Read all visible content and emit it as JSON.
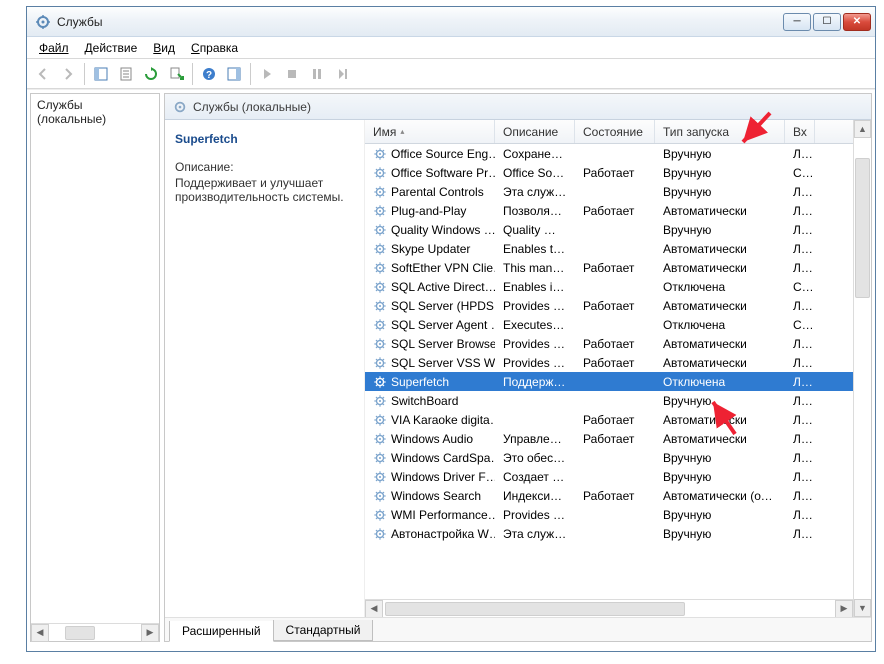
{
  "window": {
    "title": "Службы"
  },
  "menu": {
    "file": "Файл",
    "action": "Действие",
    "view": "Вид",
    "help": "Справка"
  },
  "left_tree": {
    "root": "Службы (локальные)"
  },
  "right_header": {
    "title": "Службы (локальные)"
  },
  "detail": {
    "name": "Superfetch",
    "desc_label": "Описание:",
    "desc_text": "Поддерживает и улучшает производительность системы."
  },
  "columns": {
    "name": "Имя",
    "desc": "Описание",
    "state": "Состояние",
    "start": "Тип запуска",
    "logon": "Вх"
  },
  "services": [
    {
      "name": "Office  Source Eng…",
      "desc": "Сохранен…",
      "state": "",
      "start": "Вручную",
      "logon": "Ло"
    },
    {
      "name": "Office Software Pr…",
      "desc": "Office Soft…",
      "state": "Работает",
      "start": "Вручную",
      "logon": "Се"
    },
    {
      "name": "Parental Controls",
      "desc": "Эта служб…",
      "state": "",
      "start": "Вручную",
      "logon": "Ло"
    },
    {
      "name": "Plug-and-Play",
      "desc": "Позволяет…",
      "state": "Работает",
      "start": "Автоматически",
      "logon": "Ло"
    },
    {
      "name": "Quality Windows …",
      "desc": "Quality Wi…",
      "state": "",
      "start": "Вручную",
      "logon": "Ло"
    },
    {
      "name": "Skype Updater",
      "desc": "Enables th…",
      "state": "",
      "start": "Автоматически",
      "logon": "Ло"
    },
    {
      "name": "SoftEther VPN Clie…",
      "desc": "This mana…",
      "state": "Работает",
      "start": "Автоматически",
      "logon": "Ло"
    },
    {
      "name": "SQL Active Direct…",
      "desc": "Enables int…",
      "state": "",
      "start": "Отключена",
      "logon": "Се"
    },
    {
      "name": "SQL Server (HPDS…",
      "desc": "Provides st…",
      "state": "Работает",
      "start": "Автоматически",
      "logon": "Ло"
    },
    {
      "name": "SQL Server Agent …",
      "desc": "Executes jo…",
      "state": "",
      "start": "Отключена",
      "logon": "Се"
    },
    {
      "name": "SQL Server Browser",
      "desc": "Provides S…",
      "state": "Работает",
      "start": "Автоматически",
      "logon": "Ло"
    },
    {
      "name": "SQL Server VSS Wr…",
      "desc": "Provides th…",
      "state": "Работает",
      "start": "Автоматически",
      "logon": "Ло"
    },
    {
      "name": "Superfetch",
      "desc": "Поддержи…",
      "state": "",
      "start": "Отключена",
      "logon": "Ло",
      "selected": true
    },
    {
      "name": "SwitchBoard",
      "desc": "",
      "state": "",
      "start": "Вручную",
      "logon": "Ло"
    },
    {
      "name": "VIA Karaoke digita…",
      "desc": "",
      "state": "Работает",
      "start": "Автоматически",
      "logon": "Ло"
    },
    {
      "name": "Windows Audio",
      "desc": "Управлен…",
      "state": "Работает",
      "start": "Автоматически",
      "logon": "Ло"
    },
    {
      "name": "Windows CardSpa…",
      "desc": "Это обесп…",
      "state": "",
      "start": "Вручную",
      "logon": "Ло"
    },
    {
      "name": "Windows Driver F…",
      "desc": "Создает пр…",
      "state": "",
      "start": "Вручную",
      "logon": "Ло"
    },
    {
      "name": "Windows Search",
      "desc": "Индексиро…",
      "state": "Работает",
      "start": "Автоматически (от…",
      "logon": "Ло"
    },
    {
      "name": "WMI Performance…",
      "desc": "Provides p…",
      "state": "",
      "start": "Вручную",
      "logon": "Ло"
    },
    {
      "name": "Автонастройка W…",
      "desc": "Эта служб…",
      "state": "",
      "start": "Вручную",
      "logon": "Ло"
    }
  ],
  "footer_tabs": {
    "extended": "Расширенный",
    "standard": "Стандартный"
  }
}
